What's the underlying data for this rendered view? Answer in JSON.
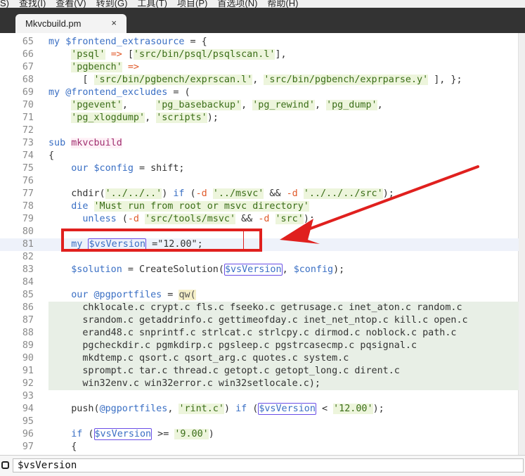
{
  "menubar": {
    "items": [
      "S)",
      "查找(I)",
      "查看(V)",
      "转到(G)",
      "工具(T)",
      "项目(P)",
      "首选项(N)",
      "帮助(H)"
    ]
  },
  "tab": {
    "title": "Mkvcbuild.pm",
    "close_glyph": "×"
  },
  "editor": {
    "lines": [
      {
        "n": "65",
        "segs": [
          [
            "kw",
            "my "
          ],
          [
            "var",
            "$frontend_extrasource"
          ],
          [
            "plain",
            " = {"
          ]
        ]
      },
      {
        "n": "66",
        "segs": [
          [
            "plain",
            "    "
          ],
          [
            "strbg",
            "'psql'"
          ],
          [
            "plain",
            " "
          ],
          [
            "op",
            "=>"
          ],
          [
            "plain",
            " ["
          ],
          [
            "strbg",
            "'src/bin/psql/psqlscan.l'"
          ],
          [
            "plain",
            "],"
          ]
        ]
      },
      {
        "n": "67",
        "segs": [
          [
            "plain",
            "    "
          ],
          [
            "strbg",
            "'pgbench'"
          ],
          [
            "plain",
            " "
          ],
          [
            "op",
            "=>"
          ]
        ]
      },
      {
        "n": "68",
        "segs": [
          [
            "plain",
            "      [ "
          ],
          [
            "strbg",
            "'src/bin/pgbench/exprscan.l'"
          ],
          [
            "plain",
            ", "
          ],
          [
            "strbg",
            "'src/bin/pgbench/exprparse.y'"
          ],
          [
            "plain",
            " ], };"
          ]
        ]
      },
      {
        "n": "69",
        "segs": [
          [
            "kw",
            "my "
          ],
          [
            "var",
            "@frontend_excludes"
          ],
          [
            "plain",
            " = ("
          ]
        ]
      },
      {
        "n": "70",
        "segs": [
          [
            "plain",
            "    "
          ],
          [
            "strbg",
            "'pgevent'"
          ],
          [
            "plain",
            ",     "
          ],
          [
            "strbg",
            "'pg_basebackup'"
          ],
          [
            "plain",
            ", "
          ],
          [
            "strbg",
            "'pg_rewind'"
          ],
          [
            "plain",
            ", "
          ],
          [
            "strbg",
            "'pg_dump'"
          ],
          [
            "plain",
            ","
          ]
        ]
      },
      {
        "n": "71",
        "segs": [
          [
            "plain",
            "    "
          ],
          [
            "strbg",
            "'pg_xlogdump'"
          ],
          [
            "plain",
            ", "
          ],
          [
            "strbg",
            "'scripts'"
          ],
          [
            "plain",
            ");"
          ]
        ]
      },
      {
        "n": "72",
        "segs": []
      },
      {
        "n": "73",
        "segs": [
          [
            "kw",
            "sub "
          ],
          [
            "fn",
            "mkvcbuild"
          ]
        ]
      },
      {
        "n": "74",
        "segs": [
          [
            "plain",
            "{"
          ]
        ]
      },
      {
        "n": "75",
        "segs": [
          [
            "plain",
            "    "
          ],
          [
            "kw",
            "our "
          ],
          [
            "var",
            "$config"
          ],
          [
            "plain",
            " = shift;"
          ]
        ]
      },
      {
        "n": "76",
        "segs": []
      },
      {
        "n": "77",
        "segs": [
          [
            "plain",
            "    chdir("
          ],
          [
            "strbg",
            "'../../..'"
          ],
          [
            "plain",
            ") "
          ],
          [
            "kw",
            "if"
          ],
          [
            "plain",
            " ("
          ],
          [
            "op",
            "-d"
          ],
          [
            "plain",
            " "
          ],
          [
            "strbg",
            "'../msvc'"
          ],
          [
            "plain",
            " && "
          ],
          [
            "op",
            "-d"
          ],
          [
            "plain",
            " "
          ],
          [
            "strbg",
            "'../../../src'"
          ],
          [
            "plain",
            ");"
          ]
        ]
      },
      {
        "n": "78",
        "segs": [
          [
            "plain",
            "    "
          ],
          [
            "kw",
            "die"
          ],
          [
            "plain",
            " "
          ],
          [
            "strbg",
            "'Must run from root or msvc directory'"
          ]
        ]
      },
      {
        "n": "79",
        "segs": [
          [
            "plain",
            "      "
          ],
          [
            "kw",
            "unless"
          ],
          [
            "plain",
            " ("
          ],
          [
            "op",
            "-d"
          ],
          [
            "plain",
            " "
          ],
          [
            "strbg",
            "'src/tools/msvc'"
          ],
          [
            "plain",
            " && "
          ],
          [
            "op",
            "-d"
          ],
          [
            "plain",
            " "
          ],
          [
            "strbg",
            "'src'"
          ],
          [
            "plain",
            ");"
          ]
        ]
      },
      {
        "n": "80",
        "segs": []
      },
      {
        "n": "81",
        "segs": [
          [
            "plain",
            "    "
          ],
          [
            "kw",
            "my "
          ],
          [
            "box",
            "$vsVersion"
          ],
          [
            "plain",
            " ="
          ],
          [
            "plain",
            "\"12.00\";"
          ]
        ],
        "cursor": true
      },
      {
        "n": "82",
        "segs": []
      },
      {
        "n": "83",
        "segs": [
          [
            "plain",
            "    "
          ],
          [
            "var",
            "$solution"
          ],
          [
            "plain",
            " = CreateSolution("
          ],
          [
            "box",
            "$vsVersion"
          ],
          [
            "plain",
            ", "
          ],
          [
            "var",
            "$config"
          ],
          [
            "plain",
            ");"
          ]
        ]
      },
      {
        "n": "84",
        "segs": []
      },
      {
        "n": "85",
        "segs": [
          [
            "plain",
            "    "
          ],
          [
            "kw",
            "our "
          ],
          [
            "var",
            "@pgportfiles"
          ],
          [
            "plain",
            " = "
          ],
          [
            "qw",
            "qw("
          ]
        ]
      },
      {
        "n": "86",
        "segs": [
          [
            "plain",
            "      chklocale.c crypt.c fls.c fseeko.c getrusage.c inet_aton.c random.c"
          ]
        ],
        "green": true
      },
      {
        "n": "87",
        "segs": [
          [
            "plain",
            "      srandom.c getaddrinfo.c gettimeofday.c inet_net_ntop.c kill.c open.c"
          ]
        ],
        "green": true
      },
      {
        "n": "88",
        "segs": [
          [
            "plain",
            "      erand48.c snprintf.c strlcat.c strlcpy.c dirmod.c noblock.c path.c"
          ]
        ],
        "green": true
      },
      {
        "n": "89",
        "segs": [
          [
            "plain",
            "      pgcheckdir.c pgmkdirp.c pgsleep.c pgstrcasecmp.c pqsignal.c"
          ]
        ],
        "green": true
      },
      {
        "n": "90",
        "segs": [
          [
            "plain",
            "      mkdtemp.c qsort.c qsort_arg.c quotes.c system.c"
          ]
        ],
        "green": true
      },
      {
        "n": "91",
        "segs": [
          [
            "plain",
            "      sprompt.c tar.c thread.c getopt.c getopt_long.c dirent.c"
          ]
        ],
        "green": true
      },
      {
        "n": "92",
        "segs": [
          [
            "plain",
            "      win32env.c win32error.c win32setlocale.c);"
          ]
        ],
        "green": true
      },
      {
        "n": "93",
        "segs": []
      },
      {
        "n": "94",
        "segs": [
          [
            "plain",
            "    push("
          ],
          [
            "var",
            "@pgportfiles"
          ],
          [
            "plain",
            ", "
          ],
          [
            "strbg",
            "'rint.c'"
          ],
          [
            "plain",
            ") "
          ],
          [
            "kw",
            "if"
          ],
          [
            "plain",
            " ("
          ],
          [
            "box",
            "$vsVersion"
          ],
          [
            "plain",
            " < "
          ],
          [
            "strbg",
            "'12.00'"
          ],
          [
            "plain",
            ");"
          ]
        ]
      },
      {
        "n": "95",
        "segs": []
      },
      {
        "n": "96",
        "segs": [
          [
            "plain",
            "    "
          ],
          [
            "kw",
            "if"
          ],
          [
            "plain",
            " ("
          ],
          [
            "box",
            "$vsVersion"
          ],
          [
            "plain",
            " >= "
          ],
          [
            "strbg",
            "'9.00'"
          ],
          [
            "plain",
            ")"
          ]
        ]
      },
      {
        "n": "97",
        "segs": [
          [
            "plain",
            "    {"
          ]
        ]
      }
    ]
  },
  "findbar": {
    "value": "$vsVersion"
  }
}
